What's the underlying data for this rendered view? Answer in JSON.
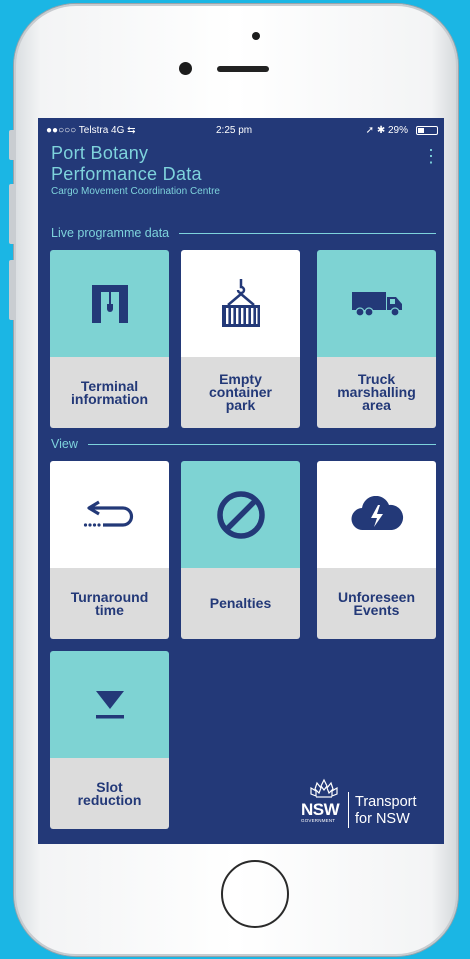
{
  "status_bar": {
    "carrier": "●●○○○ Telstra  4G ⇆",
    "time": "2:25 pm",
    "right": "➚ ✱ 29%"
  },
  "header": {
    "title_line1": "Port Botany",
    "title_line2": "Performance Data",
    "subtitle": "Cargo Movement Coordination Centre",
    "menu_icon": "more-vertical-icon"
  },
  "sections": {
    "live": "Live programme data",
    "view": "View"
  },
  "tiles": {
    "terminal": {
      "label_1": "Terminal",
      "label_2": "information",
      "icon": "crane-icon"
    },
    "empty": {
      "label_1": "Empty",
      "label_2": "container",
      "label_3": "park",
      "icon": "container-hook-icon"
    },
    "truck": {
      "label_1": "Truck",
      "label_2": "marshalling",
      "label_3": "area",
      "icon": "truck-icon"
    },
    "turnaround": {
      "label_1": "Turnaround",
      "label_2": "time",
      "icon": "turnaround-arrow-icon"
    },
    "penalties": {
      "label_1": "Penalties",
      "icon": "prohibited-icon"
    },
    "unforeseen": {
      "label_1": "Unforeseen",
      "label_2": "Events",
      "icon": "storm-cloud-icon"
    },
    "slot": {
      "label_1": "Slot",
      "label_2": "reduction",
      "icon": "down-triangle-icon"
    }
  },
  "logo": {
    "nsw": "NSW",
    "government": "GOVERNMENT",
    "transport_1": "Transport",
    "transport_2": "for NSW"
  },
  "colors": {
    "screen_bg": "#233978",
    "teal": "#7ed3d3",
    "label_bg": "#dcdcdc",
    "background": "#1bb6e4"
  }
}
